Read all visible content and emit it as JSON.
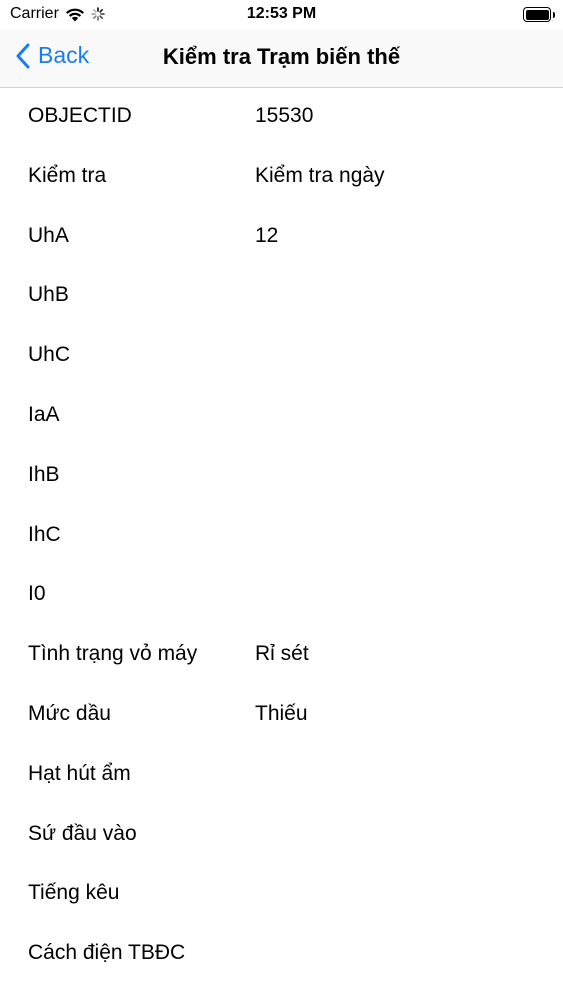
{
  "status_bar": {
    "carrier": "Carrier",
    "time": "12:53 PM"
  },
  "nav": {
    "back_label": "Back",
    "title": "Kiểm tra Trạm biến thế"
  },
  "colors": {
    "accent": "#1a7cf2",
    "nav_background": "#f9f9f9"
  },
  "rows": [
    {
      "label": "OBJECTID",
      "value": "15530"
    },
    {
      "label": "Kiểm tra",
      "value": "Kiểm tra ngày"
    },
    {
      "label": "UhA",
      "value": "12"
    },
    {
      "label": "UhB",
      "value": ""
    },
    {
      "label": "UhC",
      "value": ""
    },
    {
      "label": "IaA",
      "value": ""
    },
    {
      "label": "IhB",
      "value": ""
    },
    {
      "label": "IhC",
      "value": ""
    },
    {
      "label": "I0",
      "value": ""
    },
    {
      "label": "Tình trạng vỏ máy",
      "value": "Rỉ sét"
    },
    {
      "label": "Mức dầu",
      "value": "Thiếu"
    },
    {
      "label": "Hạt hút ẩm",
      "value": ""
    },
    {
      "label": "Sứ đầu vào",
      "value": ""
    },
    {
      "label": "Tiếng kêu",
      "value": ""
    },
    {
      "label": "Cách điện TBĐC",
      "value": ""
    }
  ]
}
